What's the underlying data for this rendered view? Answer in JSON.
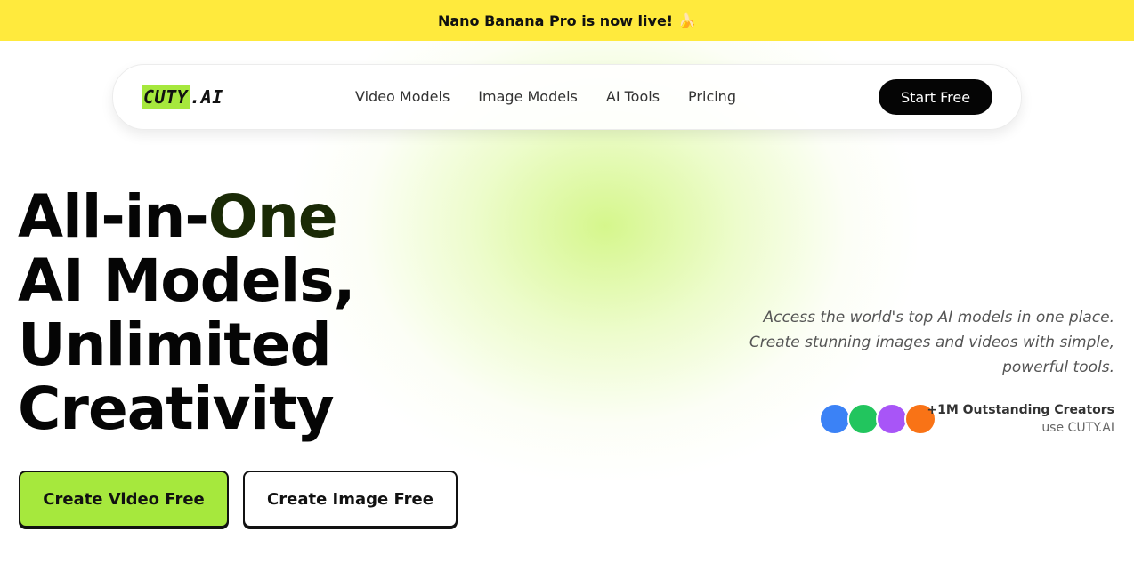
{
  "banner": {
    "text": "Nano Banana Pro is now live!",
    "emoji": "🍌"
  },
  "logo": {
    "highlight": "CUTY",
    "rest": ".AI"
  },
  "nav": {
    "links": [
      "Video Models",
      "Image Models",
      "AI Tools",
      "Pricing"
    ],
    "cta": "Start Free"
  },
  "hero": {
    "line1_a": "All-in-",
    "line1_b": "One",
    "line2": "AI Models,",
    "line3": "Unlimited",
    "line4": "Creativity",
    "btn_video": "Create Video Free",
    "btn_image": "Create Image Free"
  },
  "tagline": {
    "line1": "Access the world's top AI models in one place.",
    "line2": "Create stunning images and videos with simple,",
    "line3": "powerful tools."
  },
  "creators": {
    "headline": "+1M Outstanding Creators",
    "sub": "use CUTY.AI"
  },
  "avatar_colors": [
    "#3b82f6",
    "#22c55e",
    "#a855f7",
    "#f97316"
  ],
  "colors": {
    "banner": "#ffea3d",
    "accent": "#a6e83d",
    "cta": "#050505"
  }
}
